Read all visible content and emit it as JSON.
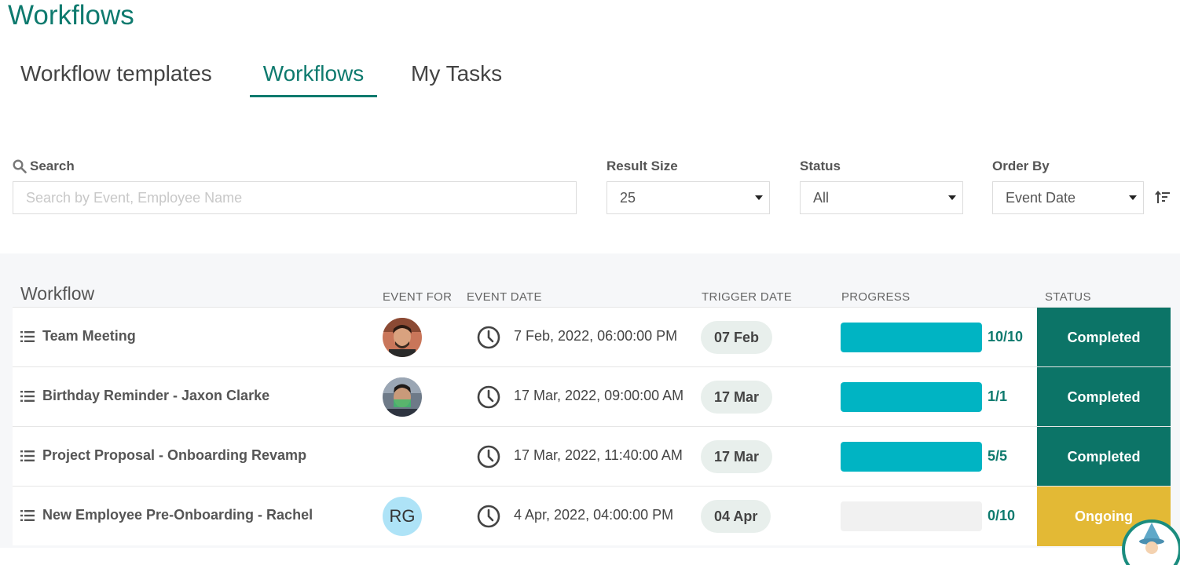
{
  "page": {
    "title": "Workflows"
  },
  "tabs": [
    {
      "label": "Workflow templates",
      "active": false
    },
    {
      "label": "Workflows",
      "active": true
    },
    {
      "label": "My Tasks",
      "active": false
    }
  ],
  "filters": {
    "search": {
      "label": "Search",
      "placeholder": "Search by Event, Employee Name",
      "value": ""
    },
    "result_size": {
      "label": "Result Size",
      "value": "25"
    },
    "status": {
      "label": "Status",
      "value": "All"
    },
    "order_by": {
      "label": "Order By",
      "value": "Event Date"
    }
  },
  "table": {
    "headers": {
      "workflow": "Workflow",
      "event_for": "EVENT FOR",
      "event_date": "EVENT DATE",
      "trigger_date": "TRIGGER DATE",
      "progress": "PROGRESS",
      "status": "STATUS"
    },
    "rows": [
      {
        "name": "Team Meeting",
        "avatar": "photo",
        "event_date": "7 Feb, 2022, 06:00:00 PM",
        "trigger": "07 Feb",
        "progress_text": "10/10",
        "progress": 1.0,
        "status": "Completed",
        "status_color": "#0c7467"
      },
      {
        "name": "Birthday Reminder - Jaxon Clarke",
        "avatar": "photo",
        "event_date": "17 Mar, 2022, 09:00:00 AM",
        "trigger": "17 Mar",
        "progress_text": "1/1",
        "progress": 1.0,
        "status": "Completed",
        "status_color": "#0c7467"
      },
      {
        "name": "Project Proposal - Onboarding Revamp",
        "avatar": "",
        "event_date": "17 Mar, 2022, 11:40:00 AM",
        "trigger": "17 Mar",
        "progress_text": "5/5",
        "progress": 1.0,
        "status": "Completed",
        "status_color": "#0c7467"
      },
      {
        "name": "New Employee Pre-Onboarding - Rachel",
        "avatar": "RG",
        "event_date": "4 Apr, 2022, 04:00:00 PM",
        "trigger": "04 Apr",
        "progress_text": "0/10",
        "progress": 0.0,
        "status": "Ongoing",
        "status_color": "#e3b935"
      }
    ]
  },
  "colors": {
    "accent": "#0e7a6e",
    "progress": "#00b4c3",
    "completed": "#0c7467",
    "ongoing": "#e3b935"
  },
  "icons": [
    "search-icon",
    "chevron-down-icon",
    "sort-icon",
    "list-icon",
    "clock-icon"
  ]
}
